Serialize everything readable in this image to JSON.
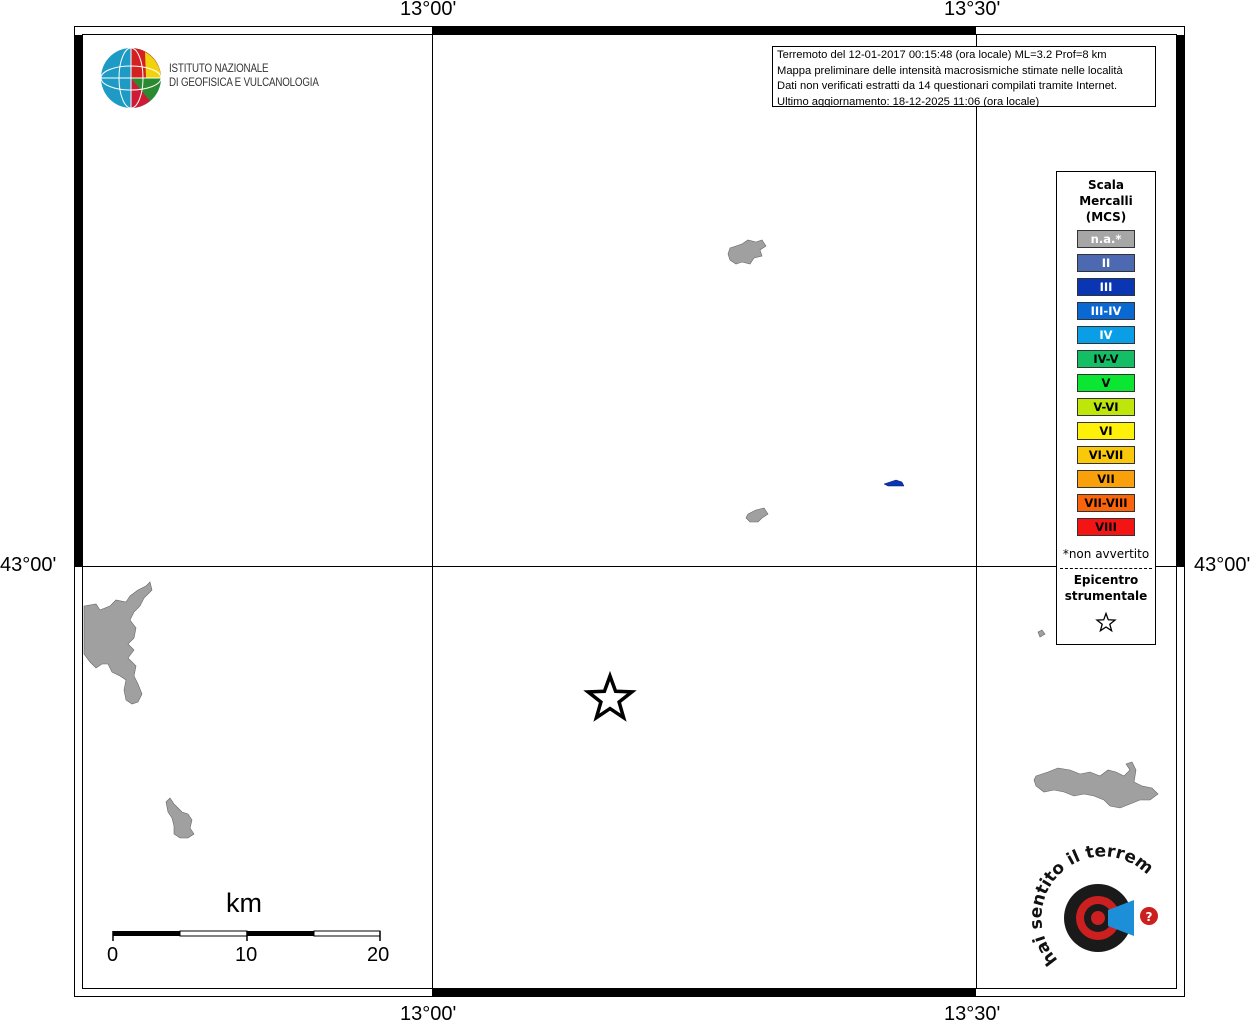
{
  "axes": {
    "top_labels": [
      "13°00'",
      "13°30'"
    ],
    "bottom_labels": [
      "13°00'",
      "13°30'"
    ],
    "left_label": "43°00'",
    "right_label": "43°00'"
  },
  "header_logo": {
    "line1": "ISTITUTO NAZIONALE",
    "line2": "DI GEOFISICA E VULCANOLOGIA"
  },
  "info": {
    "line1": "Terremoto del 12-01-2017 00:15:48 (ora locale) ML=3.2 Prof=8 km",
    "line2": "Mappa preliminare delle intensità macrosismiche stimate nelle località",
    "line3": "Dati non verificati estratti da 14 questionari compilati tramite Internet.",
    "line4": "Ultimo aggiornamento: 18-12-2025 11:06 (ora locale)"
  },
  "legend": {
    "title_l1": "Scala",
    "title_l2": "Mercalli",
    "title_l3": "(MCS)",
    "classes": [
      {
        "label": "n.a.*",
        "color": "#a6a6a6",
        "text_color": "#ffffff"
      },
      {
        "label": "II",
        "color": "#4d69b1",
        "text_color": "#ffffff"
      },
      {
        "label": "III",
        "color": "#0a36b4",
        "text_color": "#ffffff"
      },
      {
        "label": "III-IV",
        "color": "#0a68d2",
        "text_color": "#ffffff"
      },
      {
        "label": "IV",
        "color": "#0a9ee6",
        "text_color": "#ffffff"
      },
      {
        "label": "IV-V",
        "color": "#14be64",
        "text_color": "#000000"
      },
      {
        "label": "V",
        "color": "#0ae632",
        "text_color": "#000000"
      },
      {
        "label": "V-VI",
        "color": "#bee60a",
        "text_color": "#000000"
      },
      {
        "label": "VI",
        "color": "#fff00a",
        "text_color": "#000000"
      },
      {
        "label": "VI-VII",
        "color": "#fac80a",
        "text_color": "#000000"
      },
      {
        "label": "VII",
        "color": "#faa00a",
        "text_color": "#000000"
      },
      {
        "label": "VII-VIII",
        "color": "#fa640a",
        "text_color": "#000000"
      },
      {
        "label": "VIII",
        "color": "#f51414",
        "text_color": "#000000"
      }
    ],
    "note": "*non avvertito",
    "epicenter_l1": "Epicentro",
    "epicenter_l2": "strumentale",
    "epicenter_icon": "star-outline-icon"
  },
  "scale_bar": {
    "title": "km",
    "ticks": [
      "0",
      "10",
      "20"
    ]
  },
  "colors": {
    "land": "#a0a0a0",
    "intensity_III": "#0a36b4",
    "frame": "#000000"
  },
  "footer_logo": {
    "text": "hai sentito il terremoto.it www."
  }
}
